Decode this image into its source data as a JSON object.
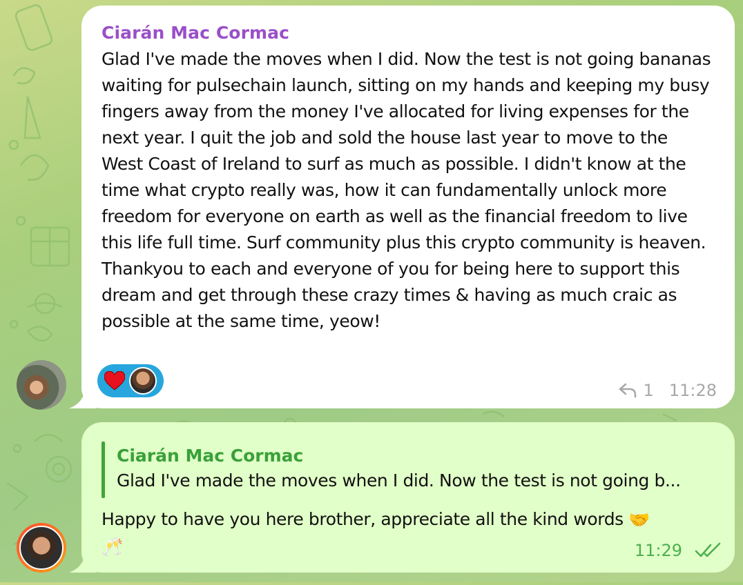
{
  "messages": [
    {
      "sender": "Ciarán Mac Cormac",
      "text": "Glad I've made the moves when I did. Now the test is not going bananas waiting for pulsechain launch, sitting on my hands and keeping my busy fingers away from the money I've allocated for living expenses for the next year. I quit the job and sold the house last year to move to the West Coast of Ireland to surf as much as possible. I didn't know at the time what crypto really was, how it can fundamentally unlock more freedom for everyone on earth as well as the financial freedom to live this life full time. Surf community plus this crypto community is heaven. Thankyou to each and everyone of you for being here to support this dream and get through these crazy times & having as much craic as possible at the same time, yeow!",
      "reactions": [
        {
          "icon": "heart-icon"
        },
        {
          "icon": "reactor-avatar"
        }
      ],
      "reply_count": "1",
      "time": "11:28"
    },
    {
      "quote": {
        "name": "Ciarán Mac Cormac",
        "text": "Glad I've made the moves when I did. Now the test is not going b..."
      },
      "text": "Happy to have you here brother, appreciate all the kind words",
      "emojis": [
        "🤝",
        "🥂"
      ],
      "time": "11:29",
      "status": "read"
    }
  ],
  "colors": {
    "incoming_bubble": "#ffffff",
    "outgoing_bubble": "#e1ffc8",
    "sender_name": "#9a4fc8",
    "quote_name": "#3aa03a",
    "reaction_pill": "#27a6dd",
    "outgoing_meta": "#4caf50",
    "incoming_meta": "#a8a8a8"
  }
}
